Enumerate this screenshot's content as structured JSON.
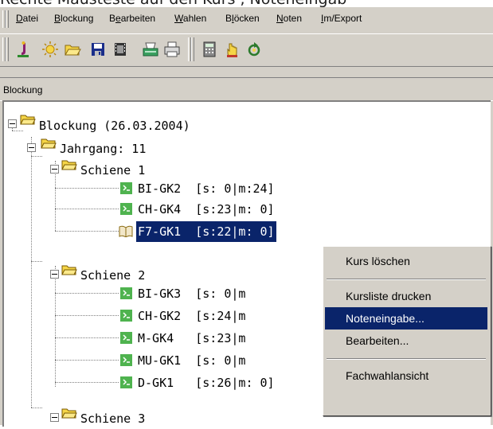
{
  "caption": "Rechte Mausteste auf den Kurs , Noteneingab",
  "menubar": {
    "items": [
      {
        "pre": "",
        "u": "D",
        "post": "atei"
      },
      {
        "pre": "",
        "u": "B",
        "post": "lockung"
      },
      {
        "pre": "B",
        "u": "e",
        "post": "arbeiten"
      },
      {
        "pre": "",
        "u": "W",
        "post": "ahlen"
      },
      {
        "pre": "B",
        "u": "l",
        "post": "öcken"
      },
      {
        "pre": "",
        "u": "N",
        "post": "oten"
      },
      {
        "pre": "",
        "u": "I",
        "post": "m/Export"
      }
    ]
  },
  "toolbar": {
    "icons": [
      "logo-j-icon",
      "sun-icon",
      "folder-open-icon",
      "save-disk-icon",
      "film-icon",
      "paper-tray-icon",
      "printer-icon",
      "calculator-icon",
      "hand-icon",
      "refresh-icon"
    ]
  },
  "panel": {
    "title": "Blockung"
  },
  "tree": {
    "root": "Blockung (26.03.2004)",
    "jahrgang": "Jahrgang: 11",
    "schienen": [
      {
        "label": "Schiene 1",
        "kurse": [
          {
            "name": "BI-GK2",
            "stat": "[s: 0|m:24]"
          },
          {
            "name": "CH-GK4",
            "stat": "[s:23|m: 0]"
          },
          {
            "name": "F7-GK1",
            "stat": "[s:22|m: 0]"
          }
        ]
      },
      {
        "label": "Schiene 2",
        "kurse": [
          {
            "name": "BI-GK3",
            "stat": "[s: 0|m"
          },
          {
            "name": "CH-GK2",
            "stat": "[s:24|m"
          },
          {
            "name": "M-GK4",
            "stat": "[s:23|m"
          },
          {
            "name": "MU-GK1",
            "stat": "[s: 0|m"
          },
          {
            "name": "D-GK1",
            "stat": "[s:26|m: 0]"
          }
        ]
      },
      {
        "label": "Schiene 3"
      }
    ]
  },
  "context_menu": {
    "items": [
      "Kurs löschen",
      "Kursliste drucken",
      "Noteneingabe...",
      "Bearbeiten...",
      "Fachwahlansicht"
    ],
    "active": "Noteneingabe..."
  },
  "colors": {
    "selection": "#0a246a",
    "folder": "#f5d547",
    "course_green": "#4fb34f"
  }
}
